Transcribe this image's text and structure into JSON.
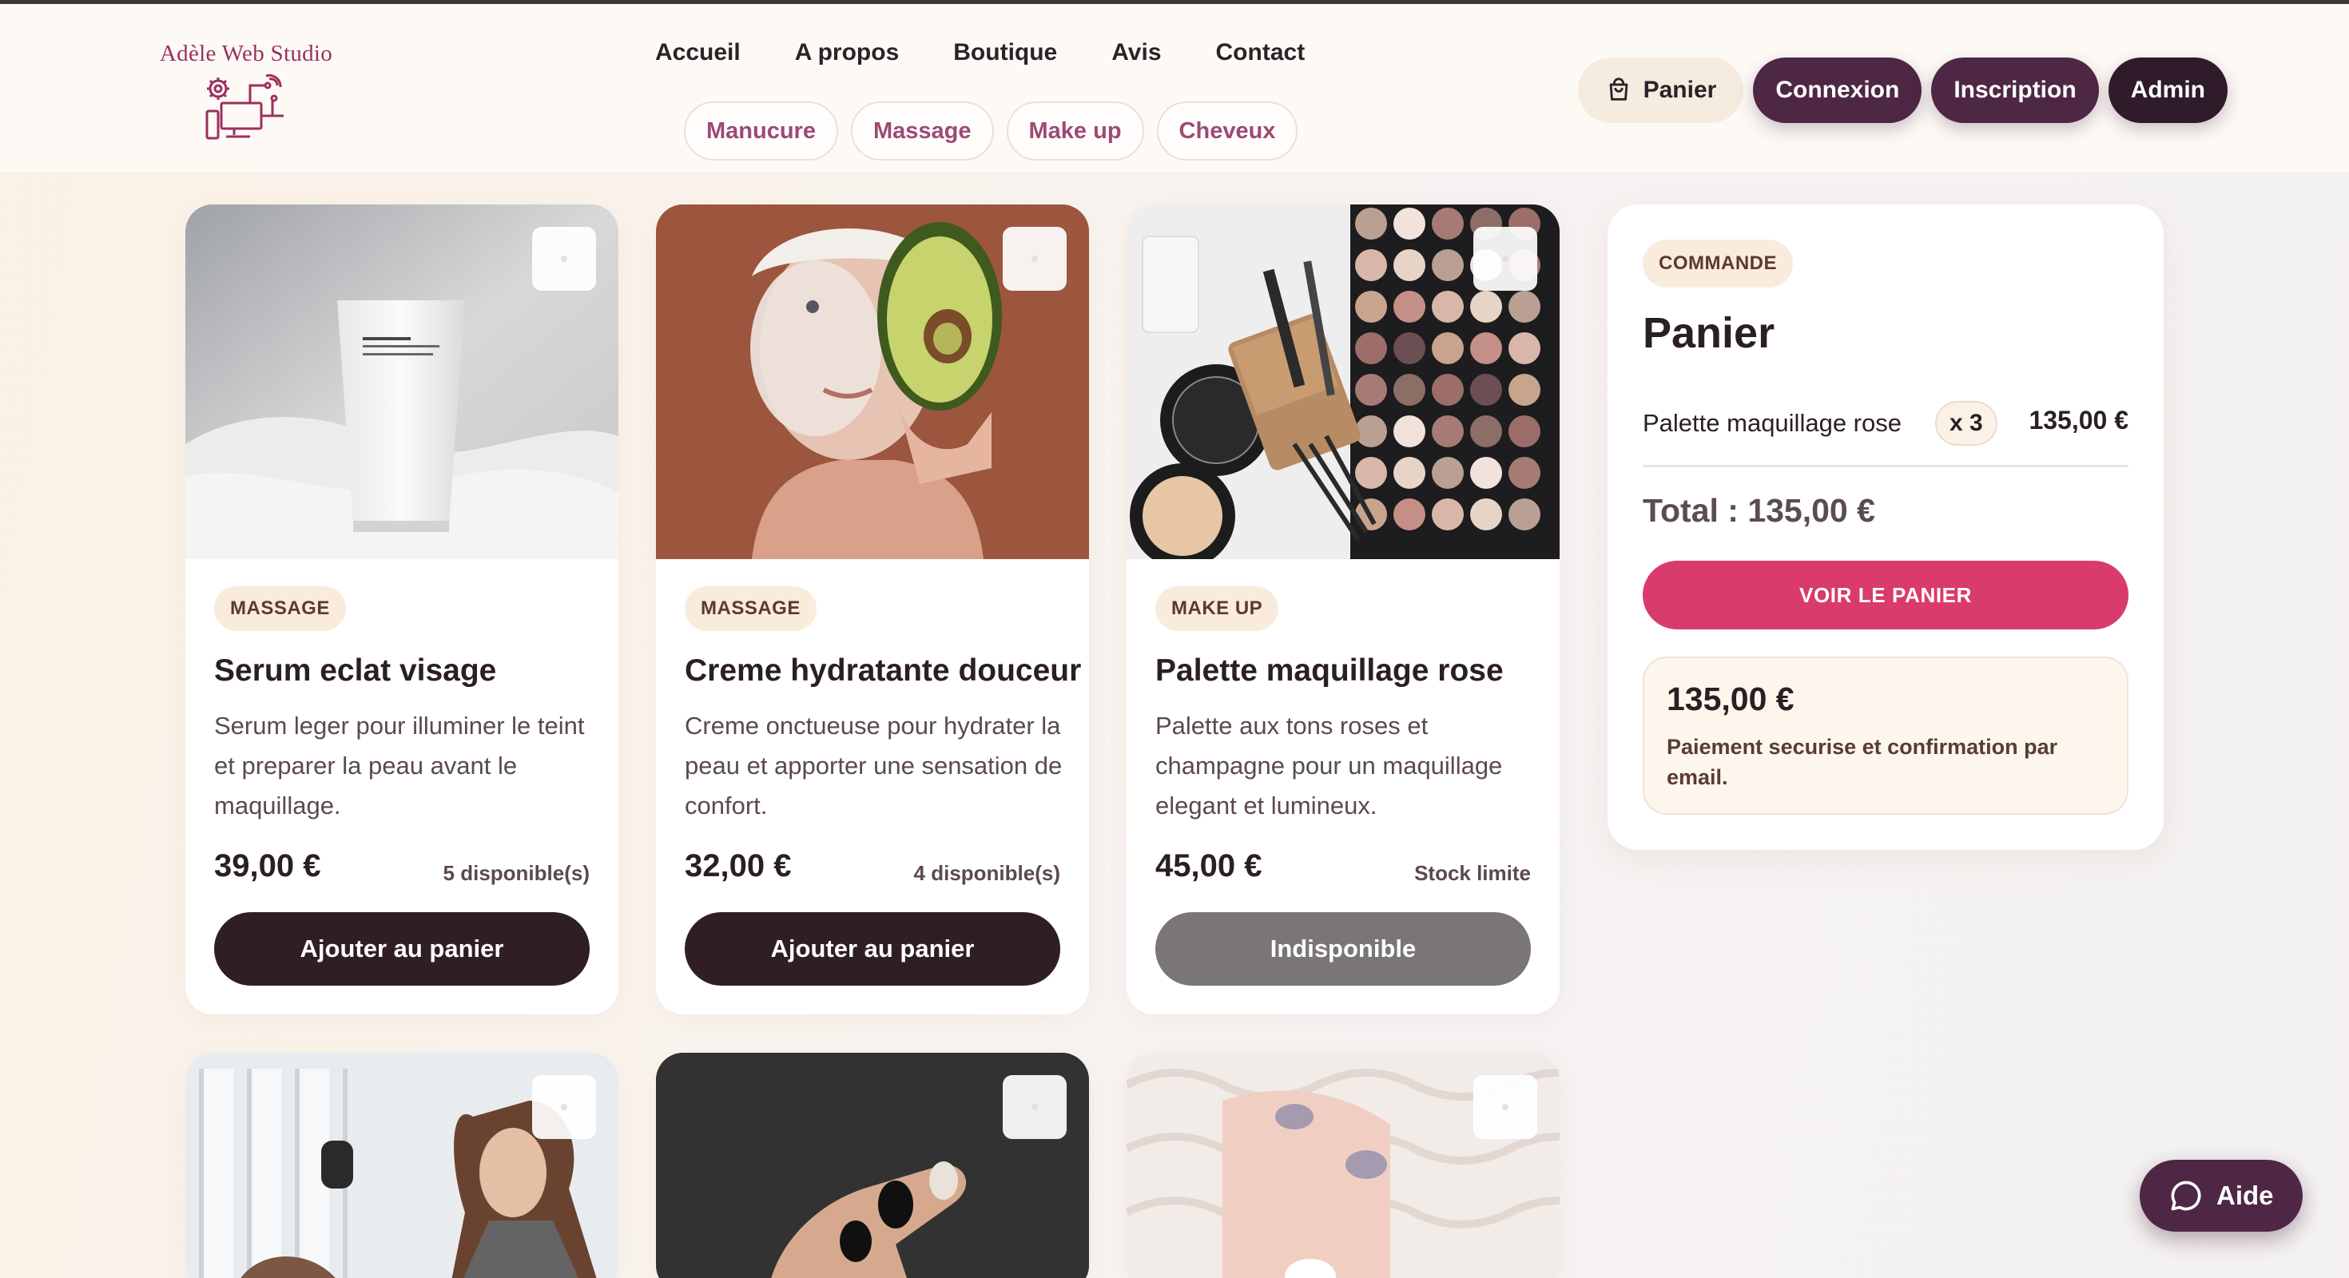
{
  "brand": {
    "name": "Adèle Web Studio",
    "color": "#9c2f5e"
  },
  "nav": {
    "main": [
      "Accueil",
      "A propos",
      "Boutique",
      "Avis",
      "Contact"
    ],
    "categories": [
      "Manucure",
      "Massage",
      "Make up",
      "Cheveux"
    ]
  },
  "header_actions": {
    "cart_label": "Panier",
    "cart_icon": "shopping-bag-icon",
    "login_label": "Connexion",
    "signup_label": "Inscription",
    "admin_label": "Admin"
  },
  "products": [
    {
      "category": "MASSAGE",
      "title": "Serum eclat visage",
      "description": "Serum leger pour illuminer le teint et preparer la peau avant le maquillage.",
      "price": "39,00 €",
      "stock": "5 disponible(s)",
      "cta": "Ajouter au panier",
      "available": true
    },
    {
      "category": "MASSAGE",
      "title": "Creme hydratante douceur",
      "description": "Creme onctueuse pour hydrater la peau et apporter une sensation de confort.",
      "price": "32,00 €",
      "stock": "4 disponible(s)",
      "cta": "Ajouter au panier",
      "available": true
    },
    {
      "category": "MAKE UP",
      "title": "Palette maquillage rose",
      "description": "Palette aux tons roses et champagne pour un maquillage elegant et lumineux.",
      "price": "45,00 €",
      "stock": "Stock limite",
      "cta": "Indisponible",
      "available": false
    }
  ],
  "cart": {
    "tag": "COMMANDE",
    "title": "Panier",
    "items": [
      {
        "name": "Palette maquillage rose",
        "qty": "x 3",
        "amount": "135,00 €"
      }
    ],
    "total": "Total : 135,00 €",
    "view_button": "VOIR LE PANIER",
    "summary_amount": "135,00 €",
    "summary_note": "Paiement securise et confirmation par email."
  },
  "help": {
    "label": "Aide",
    "icon": "chat-bubble-icon"
  },
  "colors": {
    "accent": "#d93b6c",
    "plum": "#4e2744",
    "dark": "#2f1f24",
    "tag_bg": "#f9ecdc"
  }
}
